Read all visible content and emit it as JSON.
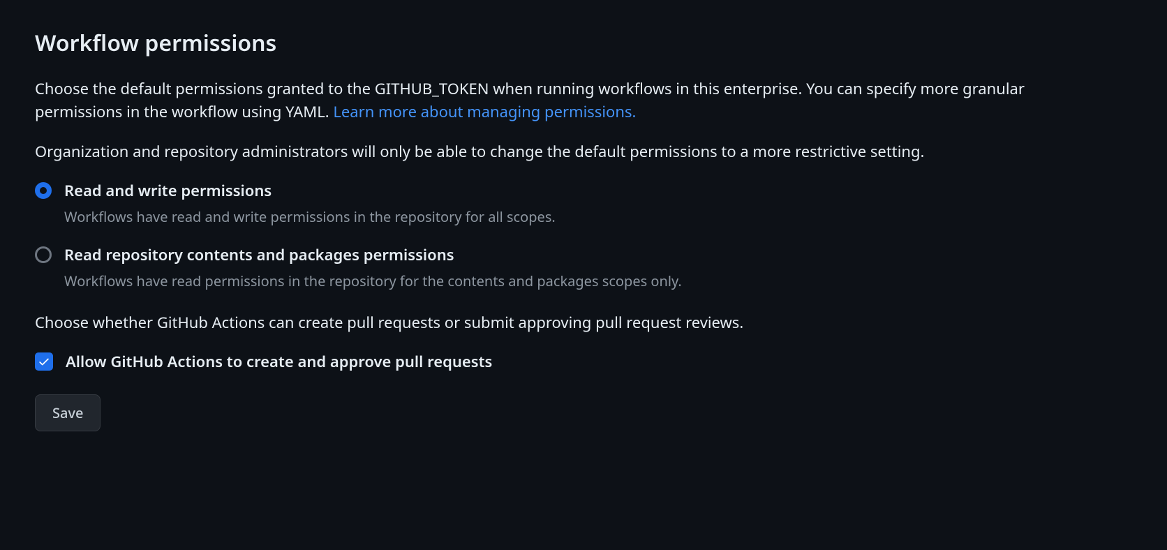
{
  "heading": "Workflow permissions",
  "description1_part1": "Choose the default permissions granted to the GITHUB_TOKEN when running workflows in this enterprise. You can specify more granular permissions in the workflow using YAML. ",
  "description1_link": "Learn more about managing permissions.",
  "description2": "Organization and repository administrators will only be able to change the default permissions to a more restrictive setting.",
  "radio_options": {
    "read_write": {
      "label": "Read and write permissions",
      "description": "Workflows have read and write permissions in the repository for all scopes.",
      "selected": true
    },
    "read_only": {
      "label": "Read repository contents and packages permissions",
      "description": "Workflows have read permissions in the repository for the contents and packages scopes only.",
      "selected": false
    }
  },
  "description3": "Choose whether GitHub Actions can create pull requests or submit approving pull request reviews.",
  "checkbox": {
    "label": "Allow GitHub Actions to create and approve pull requests",
    "checked": true
  },
  "save_button_label": "Save"
}
